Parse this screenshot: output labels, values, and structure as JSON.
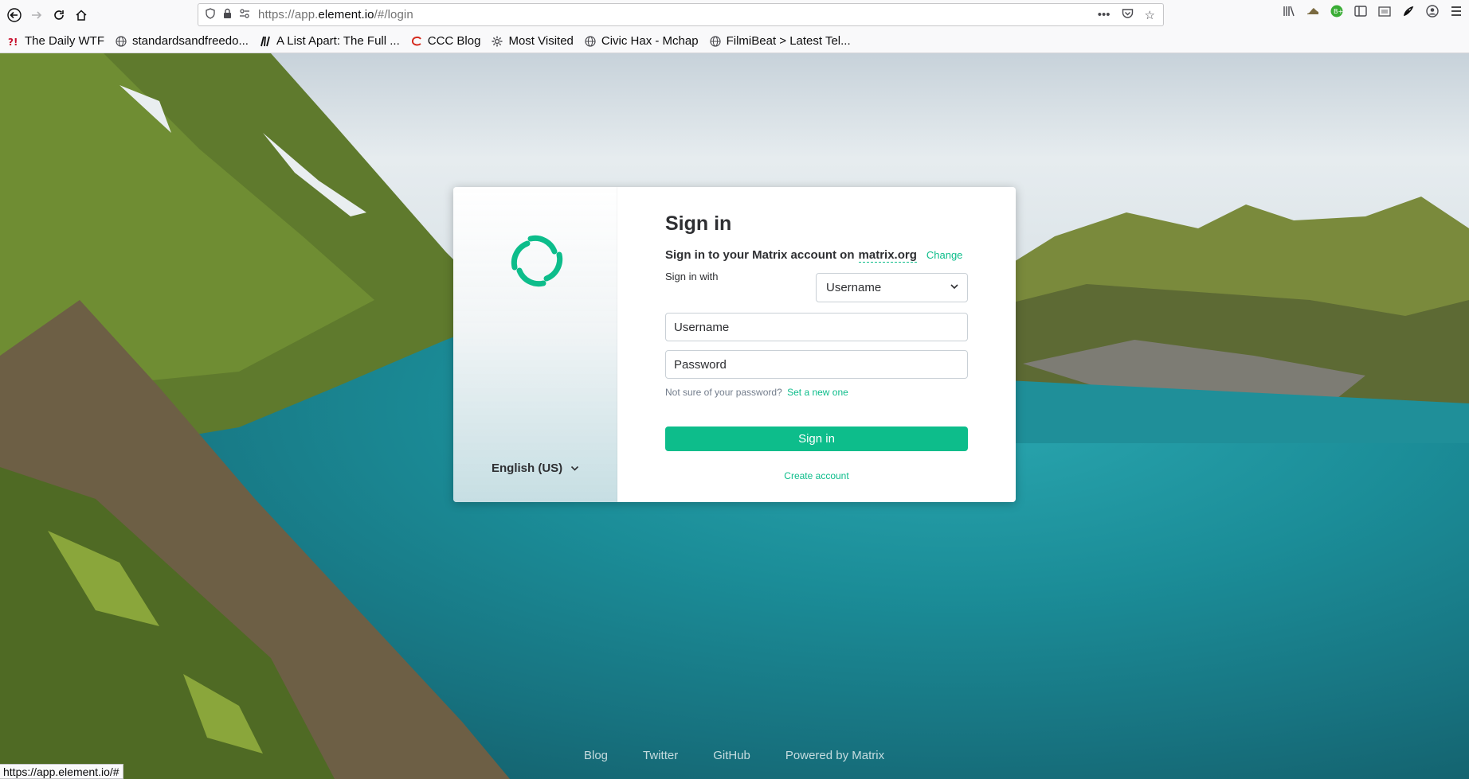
{
  "browser": {
    "url_prefix": "https://app.",
    "url_domain": "element.io",
    "url_suffix": "/#/login",
    "bookmarks": [
      {
        "label": "The Daily WTF",
        "icon": "wtf-icon"
      },
      {
        "label": "standardsandfreedo...",
        "icon": "globe-icon"
      },
      {
        "label": "A List Apart: The Full ...",
        "icon": "alistapart-icon"
      },
      {
        "label": "CCC Blog",
        "icon": "ccc-icon"
      },
      {
        "label": "Most Visited",
        "icon": "gear-icon"
      },
      {
        "label": "Civic Hax - Mchap",
        "icon": "globe-icon"
      },
      {
        "label": "FilmiBeat > Latest Tel...",
        "icon": "globe-icon"
      }
    ],
    "status_url": "https://app.element.io/#"
  },
  "auth": {
    "title": "Sign in",
    "subtitle_prefix": "Sign in to your Matrix account on",
    "server": "matrix.org",
    "change_label": "Change",
    "sign_in_with_label": "Sign in with",
    "login_type_selected": "Username",
    "username_placeholder": "Username",
    "password_placeholder": "Password",
    "forgot_prefix": "Not sure of your password?",
    "forgot_link": "Set a new one",
    "submit_label": "Sign in",
    "create_account_label": "Create account",
    "language": "English (US)"
  },
  "footer": {
    "links": [
      "Blog",
      "Twitter",
      "GitHub",
      "Powered by Matrix"
    ]
  },
  "colors": {
    "accent": "#0dbd8b",
    "text": "#2e2f32"
  }
}
